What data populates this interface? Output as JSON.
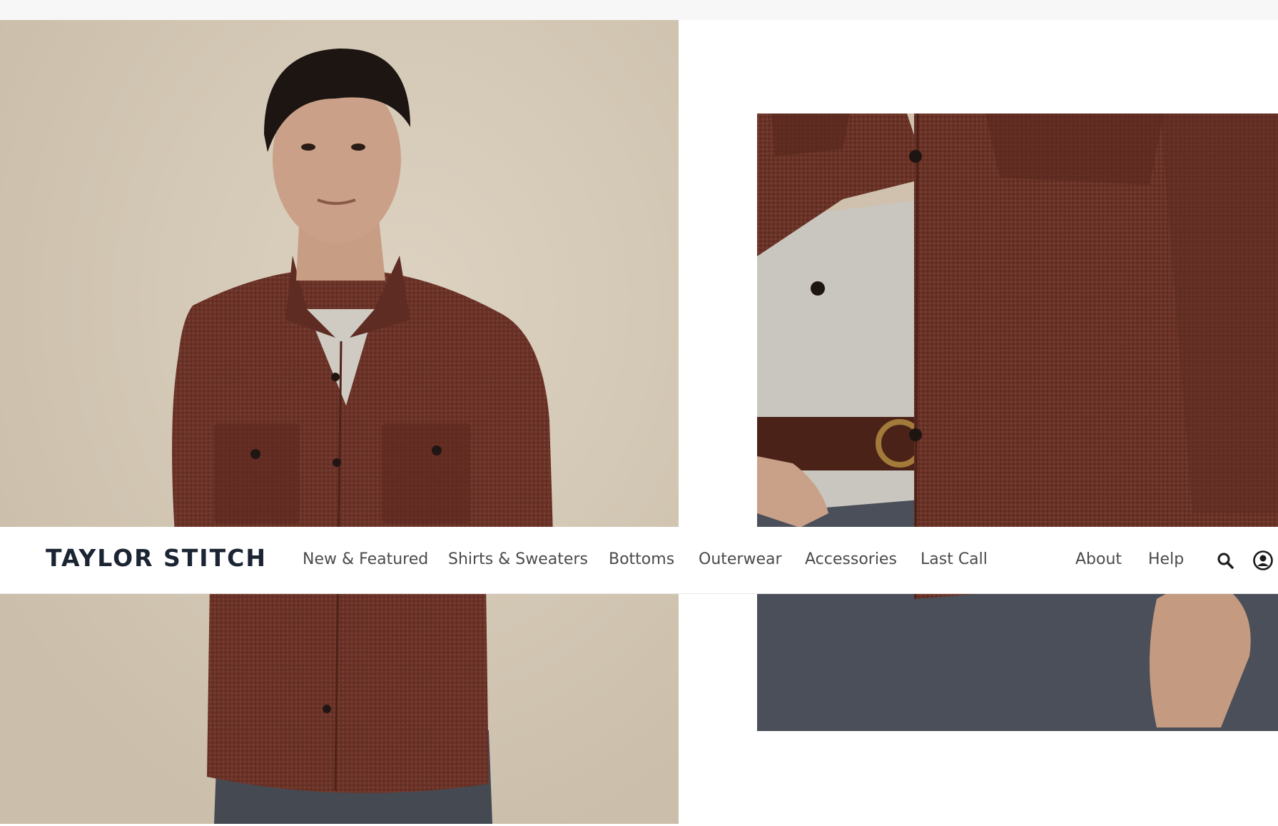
{
  "brand": {
    "logo_text": "TAYLOR STITCH"
  },
  "nav": {
    "items": [
      {
        "label": "New & Featured"
      },
      {
        "label": "Shirts & Sweaters"
      },
      {
        "label": "Bottoms"
      },
      {
        "label": "Outerwear"
      },
      {
        "label": "Accessories"
      },
      {
        "label": "Last Call"
      }
    ],
    "secondary": [
      {
        "label": "About"
      },
      {
        "label": "Help"
      }
    ],
    "icons": {
      "search": "search-icon",
      "account": "account-icon"
    }
  },
  "colors": {
    "logo": "#1b2433",
    "nav_text": "#4a4a4a",
    "shirt": "#6b3328",
    "backdrop": "#d6cab8",
    "denim": "#4a4f59"
  }
}
